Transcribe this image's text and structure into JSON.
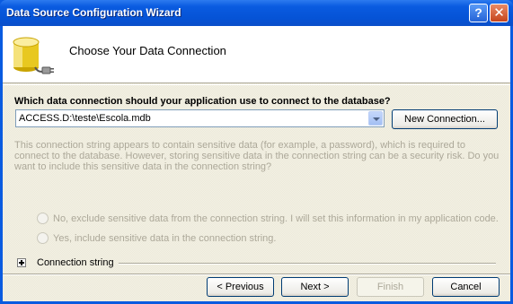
{
  "window": {
    "title": "Data Source Configuration Wizard",
    "help_label": "?",
    "close_label": "✕"
  },
  "header": {
    "title": "Choose Your Data Connection",
    "icon": "database-connection-icon"
  },
  "connection": {
    "question": "Which data connection should your application use to connect to the database?",
    "selected_value": "ACCESS.D:\\teste\\Escola.mdb",
    "new_connection_label": "New Connection..."
  },
  "sensitive": {
    "info": "This connection string appears to contain sensitive data (for example, a password), which is required to connect to the database. However, storing sensitive data in the connection string can be a security risk. Do you want to include this sensitive data in the connection string?",
    "option_no": "No, exclude sensitive data from the connection string. I will set this information in my application code.",
    "option_yes": "Yes, include sensitive data in the connection string."
  },
  "connection_string": {
    "label": "Connection string",
    "expander_icon": "plus-icon"
  },
  "buttons": {
    "previous": "< Previous",
    "next": "Next >",
    "finish": "Finish",
    "cancel": "Cancel"
  },
  "colors": {
    "titlebar": "#0a5be0",
    "dialog_background": "#ece9d8",
    "disabled_text": "#aca899"
  }
}
